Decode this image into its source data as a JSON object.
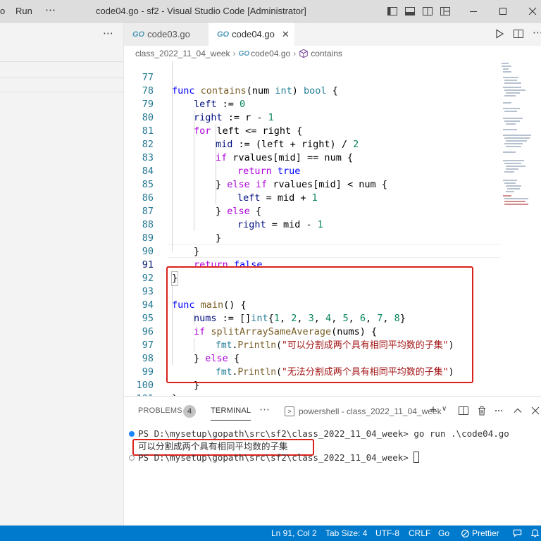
{
  "titlebar": {
    "menu_go_fragment": "o",
    "menu_run": "Run",
    "menu_more": "⋯",
    "title": "code04.go - sf2 - Visual Studio Code [Administrator]"
  },
  "sidebar": {
    "more": "⋯"
  },
  "tabs": [
    {
      "label": "code03.go",
      "active": false
    },
    {
      "label": "code04.go",
      "active": true
    }
  ],
  "tab_go_tag": "GO",
  "breadcrumb": {
    "folder": "class_2022_11_04_week",
    "file": "code04.go",
    "symbol": "contains"
  },
  "editor": {
    "active_line": 91,
    "lines": [
      {
        "n": "77"
      },
      {
        "n": "78"
      },
      {
        "n": "79"
      },
      {
        "n": "80"
      },
      {
        "n": "81"
      },
      {
        "n": "82"
      },
      {
        "n": "83"
      },
      {
        "n": "84"
      },
      {
        "n": "85"
      },
      {
        "n": "86"
      },
      {
        "n": "87"
      },
      {
        "n": "88"
      },
      {
        "n": "89"
      },
      {
        "n": "90"
      },
      {
        "n": "91"
      },
      {
        "n": "92"
      },
      {
        "n": "93"
      },
      {
        "n": "94"
      },
      {
        "n": "95"
      },
      {
        "n": "96"
      },
      {
        "n": "97"
      },
      {
        "n": "98"
      },
      {
        "n": "99"
      },
      {
        "n": "100"
      },
      {
        "n": "101"
      }
    ],
    "tokens": {
      "l77": [
        "func",
        "contains",
        "(num ",
        "int",
        ") ",
        "bool",
        " {"
      ],
      "l78": [
        "left",
        " := ",
        "0"
      ],
      "l79": [
        "right",
        " := r - ",
        "1"
      ],
      "l80": [
        "for",
        " left <= right {"
      ],
      "l81": [
        "mid",
        " := (left + right) / ",
        "2"
      ],
      "l82": [
        "if",
        " rvalues[mid] == num {"
      ],
      "l83": [
        "return",
        "true"
      ],
      "l84": [
        "} ",
        "else",
        "if",
        " rvalues[mid] < num {"
      ],
      "l85": [
        "left",
        " = mid + ",
        "1"
      ],
      "l86": [
        "} ",
        "else",
        " {"
      ],
      "l87": [
        "right",
        " = mid - ",
        "1"
      ],
      "l88": [
        "}"
      ],
      "l89": [
        "}"
      ],
      "l90": [
        "return",
        "false"
      ],
      "l91": [
        "}"
      ],
      "l93": [
        "func",
        "main",
        "() {"
      ],
      "l94": [
        "nums",
        " := []",
        "int",
        "{",
        "1",
        ", ",
        "2",
        ", ",
        "3",
        ", ",
        "4",
        ", ",
        "5",
        ", ",
        "6",
        ", ",
        "7",
        ", ",
        "8",
        "}"
      ],
      "l95": [
        "if",
        "splitArraySameAverage",
        "(nums) {"
      ],
      "l96": [
        "fmt",
        ".",
        "Println",
        "(",
        "\"可以分割成两个具有相同平均数的子集\"",
        ")"
      ],
      "l97": [
        "} ",
        "else",
        " {"
      ],
      "l98": [
        "fmt",
        ".",
        "Println",
        "(",
        "\"无法分割成两个具有相同平均数的子集\"",
        ")"
      ],
      "l99": [
        "}"
      ],
      "l100": [
        "}"
      ]
    }
  },
  "panel": {
    "problems_label": "PROBLEMS",
    "problems_count": "4",
    "terminal_label": "TERMINAL",
    "more": "⋯",
    "terminal_tab": "powershell - class_2022_11_04_week",
    "add": "+",
    "add_dropdown": "∨",
    "terminal_lines": [
      "PS D:\\mysetup\\gopath\\src\\sf2\\class_2022_11_04_week> go run .\\code04.go",
      "可以分割成两个具有相同平均数的子集",
      "PS D:\\mysetup\\gopath\\src\\sf2\\class_2022_11_04_week> "
    ]
  },
  "statusbar": {
    "position": "Ln 91, Col 2",
    "tab_size": "Tab Size: 4",
    "encoding": "UTF-8",
    "eol": "CRLF",
    "language": "Go",
    "prettier": "Prettier"
  },
  "colors": {
    "statusbar": "#007acc",
    "keyword": "#0000ff",
    "control": "#af00db",
    "string": "#a31515",
    "number": "#098658",
    "highlight_box": "#d9221c"
  }
}
